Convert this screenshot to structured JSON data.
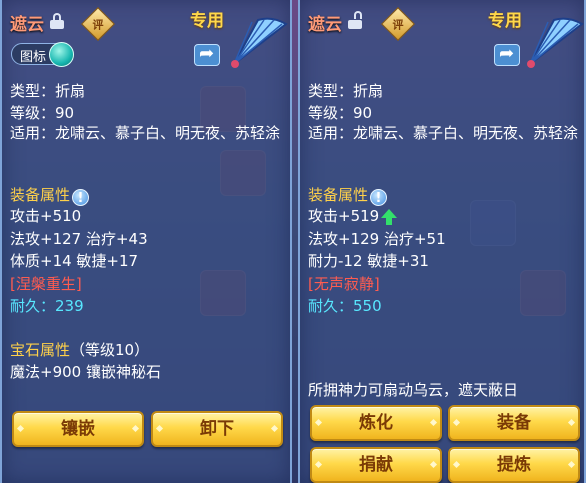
{
  "left": {
    "name": "遮云",
    "rate_badge": "评",
    "exclusive": "专用",
    "toggle_label": "图标",
    "type_line": "类型：折扇",
    "level_line": "等级：90",
    "fit_line": "适用：龙啸云、慕子白、明无夜、苏轻涂",
    "attr_title": "装备属性",
    "attack": "攻击+510",
    "magic_heal": "法攻+127 治疗+43",
    "con_agi": "体质+14 敏捷+17",
    "special": "[涅槃重生]",
    "durability_label": "耐久：",
    "durability_value": "239",
    "gem_title": "宝石属性",
    "gem_level": "（等级10）",
    "gem_effect": "魔法+900 镶嵌神秘石",
    "btn_inlay": "镶嵌",
    "btn_unequip": "卸下"
  },
  "right": {
    "name": "遮云",
    "rate_badge": "评",
    "exclusive": "专用",
    "type_line": "类型：折扇",
    "level_line": "等级：90",
    "fit_line": "适用：龙啸云、慕子白、明无夜、苏轻涂",
    "attr_title": "装备属性",
    "attack": "攻击+519",
    "magic_heal": "法攻+129 治疗+51",
    "end_agi": "耐力-12 敏捷+31",
    "special": "[无声寂静]",
    "durability_label": "耐久：",
    "durability_value": "550",
    "description": "所拥神力可扇动乌云，遮天蔽日",
    "btn_refine": "炼化",
    "btn_equip": "装备",
    "btn_donate": "捐献",
    "btn_extract": "提炼"
  },
  "colors": {
    "name": "#ff9a78",
    "section": "#ffd14a",
    "special": "#ff5c50",
    "durability": "#58e8ff",
    "button": "#ffd94a"
  },
  "icons": [
    "lock-icon",
    "unlock-icon",
    "rate-badge",
    "fan-icon",
    "share-icon",
    "info-icon",
    "up-arrow-icon"
  ]
}
